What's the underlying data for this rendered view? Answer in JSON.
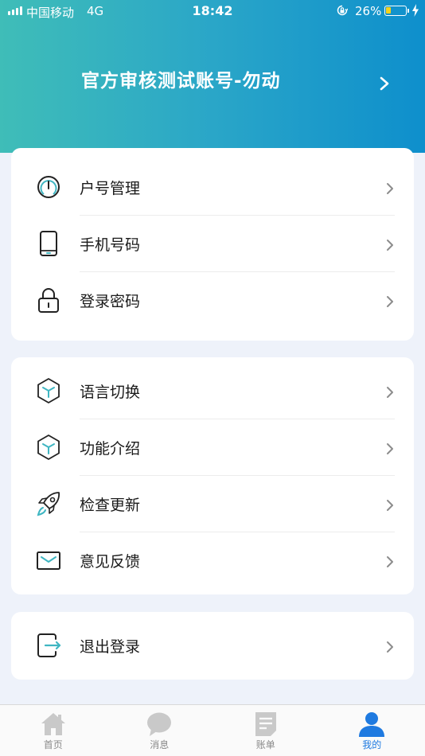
{
  "status_bar": {
    "carrier": "中国移动",
    "network": "4G",
    "time": "18:42",
    "battery": "26%",
    "battery_level": 0.26
  },
  "account": {
    "name": "官方审核测试账号-勿动"
  },
  "card_account": {
    "items": [
      {
        "label": "户号管理",
        "icon": "dial-gauge-icon"
      },
      {
        "label": "手机号码",
        "icon": "mobile-phone-icon"
      },
      {
        "label": "登录密码",
        "icon": "lock-icon"
      }
    ]
  },
  "card_settings": {
    "items": [
      {
        "label": "语言切换",
        "icon": "cube-icon"
      },
      {
        "label": "功能介绍",
        "icon": "cube-icon"
      },
      {
        "label": "检查更新",
        "icon": "rocket-icon"
      },
      {
        "label": "意见反馈",
        "icon": "mail-icon"
      }
    ]
  },
  "card_logout": {
    "items": [
      {
        "label": "退出登录",
        "icon": "logout-icon"
      }
    ]
  },
  "tabbar": {
    "tabs": [
      {
        "label": "首页",
        "icon": "home-icon",
        "active": false
      },
      {
        "label": "消息",
        "icon": "message-bubble-icon",
        "active": false
      },
      {
        "label": "账单",
        "icon": "bill-icon",
        "active": false
      },
      {
        "label": "我的",
        "icon": "user-icon",
        "active": true
      }
    ]
  },
  "colors": {
    "accent": "#1f7ae0",
    "icon_teal": "#3fb6c2",
    "header_start": "#3fbdb8",
    "header_end": "#0e8fcc"
  }
}
